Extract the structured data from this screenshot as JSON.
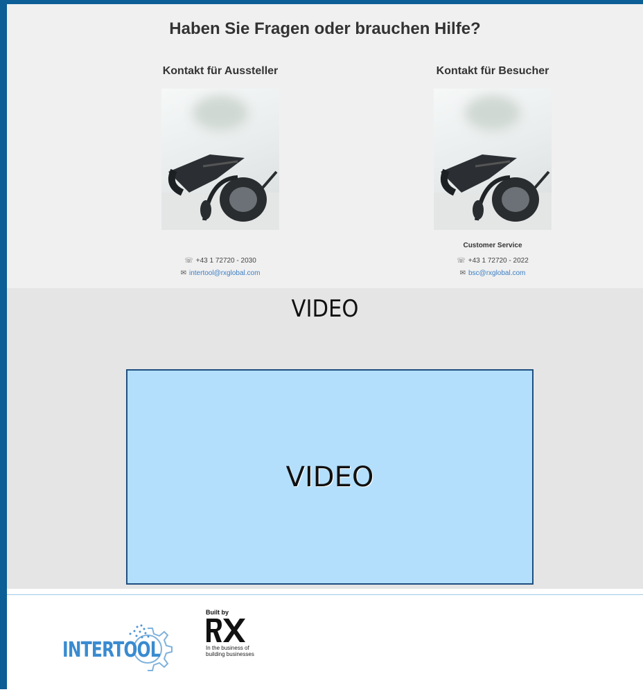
{
  "contact": {
    "heading": "Haben Sie Fragen oder brauchen Hilfe?",
    "exhibitor": {
      "title": "Kontakt für Aussteller",
      "phone": "+43 1 72720 - 2030",
      "email": "intertool@rxglobal.com"
    },
    "visitor": {
      "title": "Kontakt für Besucher",
      "subtitle": "Customer Service",
      "phone": "+43 1 72720 - 2022",
      "email": "bsc@rxglobal.com"
    },
    "icons": {
      "phone": "telephone-icon",
      "email": "envelope-icon"
    }
  },
  "video": {
    "section_title": "VIDEO",
    "placeholder": "VIDEO"
  },
  "footer": {
    "brand": "INTERTOOL",
    "built_by": "Built by",
    "rx_tagline_1": "In the business of",
    "rx_tagline_2": "building businesses"
  },
  "colors": {
    "frame": "#0b5e96",
    "contact_bg": "#f0f0f0",
    "video_bg": "#e5e5e5",
    "video_box": "#b3dffc",
    "video_border": "#1e4e80",
    "intertool_blue": "#3a8bd0",
    "link": "#3c7ec4"
  }
}
